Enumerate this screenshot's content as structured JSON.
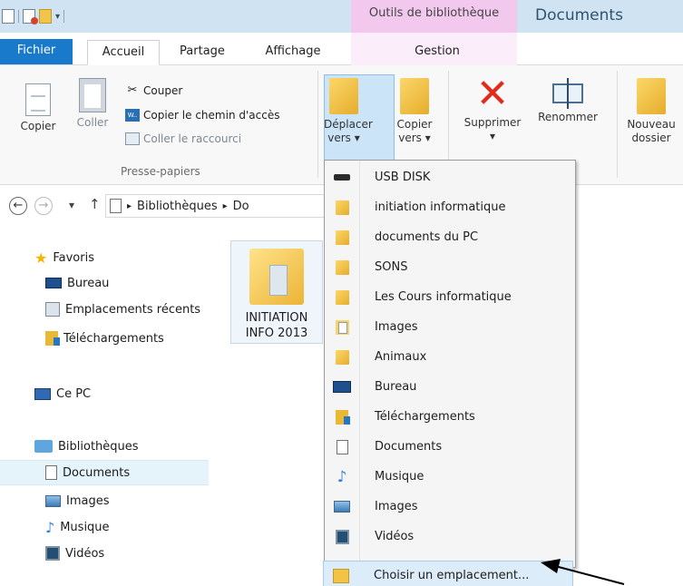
{
  "window": {
    "context_tab_label": "Outils de bibliothèque",
    "title": "Documents"
  },
  "tabs": {
    "file": "Fichier",
    "home": "Accueil",
    "share": "Partage",
    "view": "Affichage",
    "manage": "Gestion"
  },
  "ribbon": {
    "copy": "Copier",
    "paste": "Coller",
    "cut": "Couper",
    "copy_path": "Copier le chemin d'accès",
    "paste_shortcut": "Coller le raccourci",
    "clipboard_group": "Presse-papiers",
    "move_to_1": "Déplacer",
    "move_to_2": "vers ▾",
    "copy_to_1": "Copier",
    "copy_to_2": "vers ▾",
    "delete": "Supprimer",
    "delete_arrow": "▾",
    "rename": "Renommer",
    "new_folder_1": "Nouveau",
    "new_folder_2": "dossier"
  },
  "address": {
    "back": "←",
    "forward": "→",
    "recent": "▾",
    "up": "↑",
    "sep1": "▸",
    "crumb_libraries": "Bibliothèques",
    "sep2": "▸",
    "crumb_partial": "Do"
  },
  "nav": {
    "favorites": "Favoris",
    "desktop": "Bureau",
    "recent_places": "Emplacements récents",
    "downloads": "Téléchargements",
    "this_pc": "Ce PC",
    "libraries": "Bibliothèques",
    "documents": "Documents",
    "images": "Images",
    "music": "Musique",
    "videos": "Vidéos"
  },
  "content": {
    "folder_name": "INITIATION\nINFO 2013"
  },
  "move_menu": {
    "items": [
      {
        "label": "USB DISK",
        "icon": "usb-drive-icon"
      },
      {
        "label": "initiation informatique",
        "icon": "folder-icon"
      },
      {
        "label": "documents du PC",
        "icon": "folder-icon"
      },
      {
        "label": "SONS",
        "icon": "folder-icon"
      },
      {
        "label": "Les Cours informatique",
        "icon": "folder-icon"
      },
      {
        "label": "Images",
        "icon": "folder-document-icon"
      },
      {
        "label": "Animaux",
        "icon": "folder-icon"
      },
      {
        "label": "Bureau",
        "icon": "desktop-icon"
      },
      {
        "label": "Téléchargements",
        "icon": "downloads-icon"
      },
      {
        "label": "Documents",
        "icon": "document-icon"
      },
      {
        "label": "Musique",
        "icon": "music-note-icon"
      },
      {
        "label": "Images",
        "icon": "picture-icon"
      },
      {
        "label": "Vidéos",
        "icon": "film-icon"
      }
    ],
    "choose_location": "Choisir un emplacement..."
  },
  "colors": {
    "file_tab": "#1979ca",
    "context_tab": "#f2c8ee",
    "highlight": "#cbe4f8",
    "delete_red": "#df2c1b"
  }
}
